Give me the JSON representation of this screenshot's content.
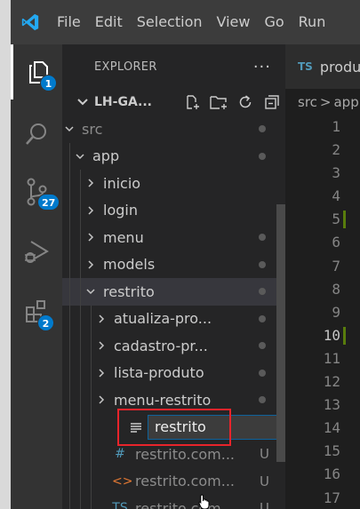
{
  "menu": [
    "File",
    "Edit",
    "Selection",
    "View",
    "Go",
    "Run"
  ],
  "activity": {
    "explorer_badge": "1",
    "scm_badge": "27",
    "extensions_badge": "2"
  },
  "explorer": {
    "title": "EXPLORER",
    "more": "···",
    "workspace": "LH-GA..."
  },
  "tree": [
    {
      "label": "src",
      "level": 0,
      "expanded": true,
      "dim": true,
      "decor": "dot"
    },
    {
      "label": "app",
      "level": 1,
      "expanded": true,
      "decor": "dot"
    },
    {
      "label": "inicio",
      "level": 2,
      "expanded": false,
      "decor": ""
    },
    {
      "label": "login",
      "level": 2,
      "expanded": false,
      "decor": ""
    },
    {
      "label": "menu",
      "level": 2,
      "expanded": false,
      "decor": "dot"
    },
    {
      "label": "models",
      "level": 2,
      "expanded": false,
      "decor": "dot"
    },
    {
      "label": "restrito",
      "level": 2,
      "expanded": true,
      "selected": true,
      "decor": "dot"
    },
    {
      "label": "atualiza-pro...",
      "level": 3,
      "expanded": false,
      "decor": "dot"
    },
    {
      "label": "cadastro-pr...",
      "level": 3,
      "expanded": false,
      "decor": "dot"
    },
    {
      "label": "lista-produto",
      "level": 3,
      "expanded": false,
      "decor": "dot"
    },
    {
      "label": "menu-restrito",
      "level": 3,
      "expanded": false,
      "decor": "dot"
    }
  ],
  "rename": {
    "value": "restrito"
  },
  "files": [
    {
      "icon": "#",
      "icon_color": "#519aba",
      "label": "restrito.com...",
      "status": "U"
    },
    {
      "icon": "<>",
      "icon_color": "#e37933",
      "label": "restrito.com...",
      "status": "U"
    },
    {
      "icon": "TS",
      "icon_color": "#519aba",
      "label": "restrito.com...",
      "status": "U"
    }
  ],
  "editor": {
    "tab_prefix": "TS",
    "tab_name": "produ",
    "breadcrumb_src": "src",
    "breadcrumb_sep": ">",
    "breadcrumb_next": "app",
    "active_line": 10,
    "modified_lines": [
      5,
      10
    ],
    "line_numbers": [
      1,
      2,
      3,
      4,
      5,
      6,
      7,
      8,
      9,
      10,
      11,
      12,
      13,
      14,
      15,
      16,
      17
    ]
  }
}
